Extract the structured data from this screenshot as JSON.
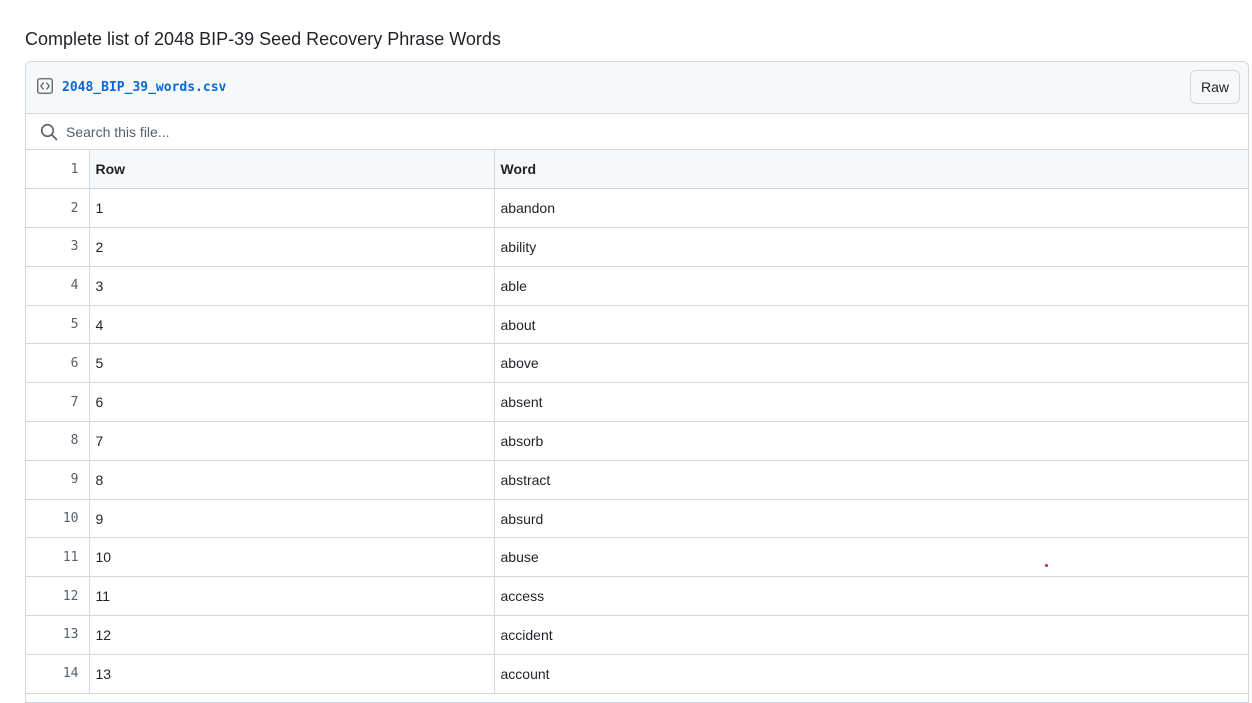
{
  "page": {
    "heading": "Complete list of 2048 BIP-39 Seed Recovery Phrase Words"
  },
  "file": {
    "name": "2048_BIP_39_words.csv",
    "raw_label": "Raw",
    "icon": "code-file-icon"
  },
  "search": {
    "placeholder": "Search this file...",
    "value": "",
    "icon": "search-icon"
  },
  "table": {
    "header_line": "1",
    "columns": [
      "Row",
      "Word"
    ],
    "rows": [
      {
        "line": "2",
        "row": "1",
        "word": "abandon"
      },
      {
        "line": "3",
        "row": "2",
        "word": "ability"
      },
      {
        "line": "4",
        "row": "3",
        "word": "able"
      },
      {
        "line": "5",
        "row": "4",
        "word": "about"
      },
      {
        "line": "6",
        "row": "5",
        "word": "above"
      },
      {
        "line": "7",
        "row": "6",
        "word": "absent"
      },
      {
        "line": "8",
        "row": "7",
        "word": "absorb"
      },
      {
        "line": "9",
        "row": "8",
        "word": "abstract"
      },
      {
        "line": "10",
        "row": "9",
        "word": "absurd"
      },
      {
        "line": "11",
        "row": "10",
        "word": "abuse"
      },
      {
        "line": "12",
        "row": "11",
        "word": "access"
      },
      {
        "line": "13",
        "row": "12",
        "word": "accident"
      },
      {
        "line": "14",
        "row": "13",
        "word": "account"
      }
    ]
  },
  "colors": {
    "link": "#0969da",
    "border": "#d0d7de",
    "header_bg": "#f6f8fa",
    "muted": "#57606a"
  }
}
